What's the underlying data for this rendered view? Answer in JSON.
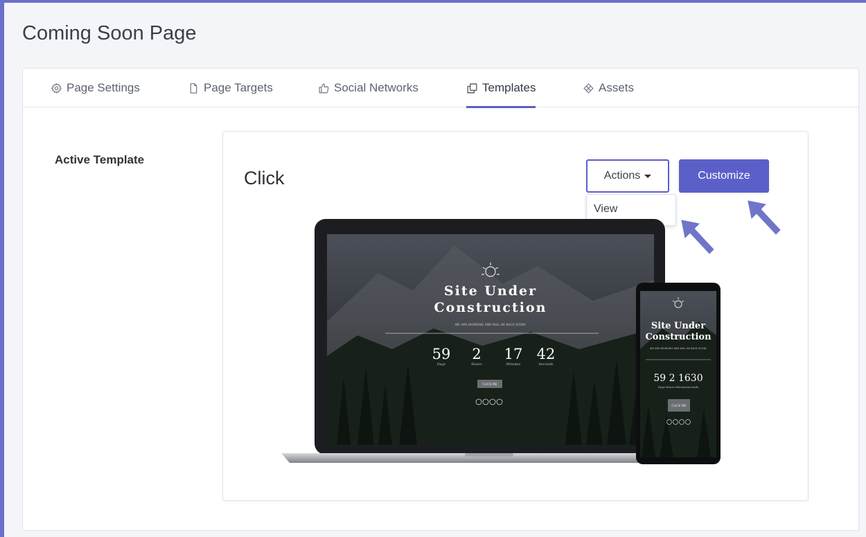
{
  "page": {
    "title": "Coming Soon Page"
  },
  "tabs": [
    {
      "label": "Page Settings",
      "icon": "gear-icon"
    },
    {
      "label": "Page Targets",
      "icon": "page-icon"
    },
    {
      "label": "Social Networks",
      "icon": "thumbs-up-icon"
    },
    {
      "label": "Templates",
      "icon": "copy-icon",
      "active": true
    },
    {
      "label": "Assets",
      "icon": "assets-icon"
    }
  ],
  "section": {
    "label": "Active Template"
  },
  "template": {
    "name": "Click",
    "actions_label": "Actions",
    "customize_label": "Customize",
    "dropdown_items": [
      "View"
    ]
  },
  "preview": {
    "laptop": {
      "heading_line1": "Site Under",
      "heading_line2": "Construction",
      "tagline": "WE ARE WORKING AND WILL BE BACK SOON!",
      "countdown": [
        {
          "value": "59",
          "unit": "Days"
        },
        {
          "value": "2",
          "unit": "Hours"
        },
        {
          "value": "17",
          "unit": "Minutes"
        },
        {
          "value": "42",
          "unit": "Seconds"
        }
      ],
      "button": "CLICK ME"
    },
    "phone": {
      "heading_line1": "Site Under",
      "heading_line2": "Construction",
      "tagline": "WE ARE WORKING AND WILL BE BACK SOON!",
      "countdown": "59 2 1630",
      "units": "Days Hours MinutesSeconds",
      "button": "CLICK ME"
    }
  },
  "colors": {
    "accent": "#5b60c9",
    "frame": "#6a6fc9",
    "arrow": "#6c72c8"
  }
}
